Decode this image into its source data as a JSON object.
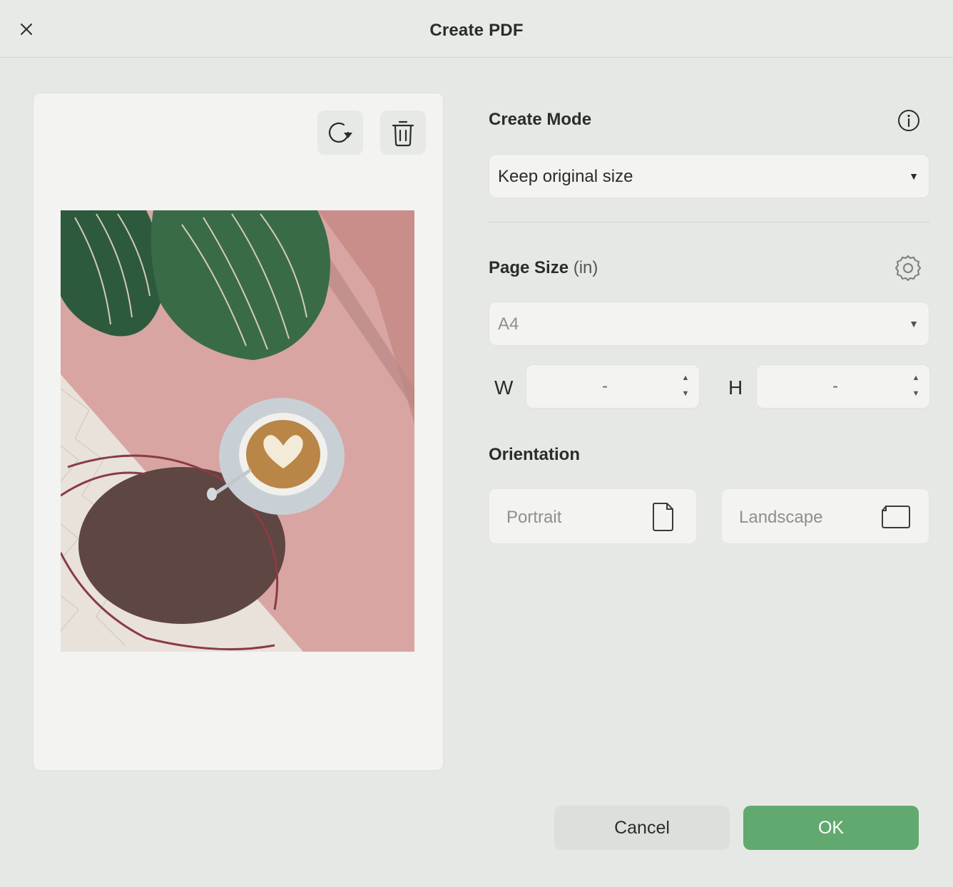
{
  "dialog": {
    "title": "Create PDF"
  },
  "preview": {
    "rotate_icon": "rotate-icon",
    "delete_icon": "trash-icon",
    "image_description_icon": "photo-thumbnail"
  },
  "create_mode": {
    "heading": "Create Mode",
    "selected": "Keep original size"
  },
  "page_size": {
    "heading": "Page Size",
    "unit": "(in)",
    "selected": "A4",
    "width_label": "W",
    "width_value": "-",
    "height_label": "H",
    "height_value": "-"
  },
  "orientation": {
    "heading": "Orientation",
    "portrait": "Portrait",
    "landscape": "Landscape"
  },
  "footer": {
    "cancel": "Cancel",
    "ok": "OK"
  },
  "colors": {
    "accent": "#61a96e",
    "background": "#e6e8e5"
  }
}
